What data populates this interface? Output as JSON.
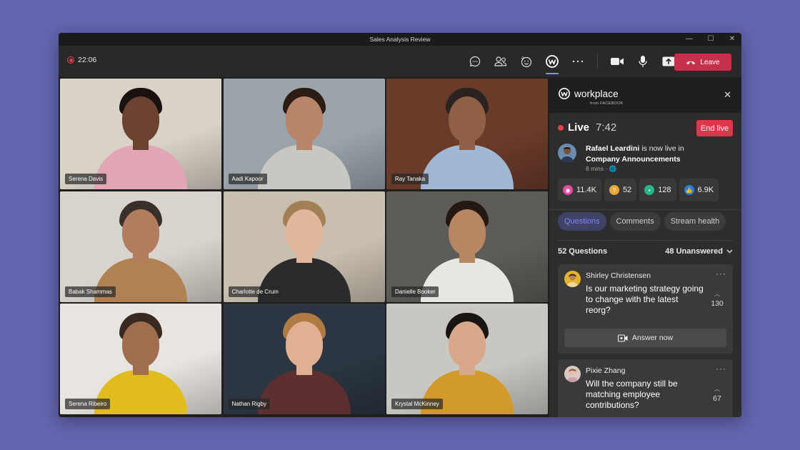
{
  "window": {
    "title": "Sales Analysis Review",
    "controls": [
      "—",
      "☐",
      "✕"
    ]
  },
  "toolbar": {
    "timer": "22:06",
    "icons": [
      "chat-icon",
      "participants-icon",
      "reactions-icon",
      "workplace-icon",
      "more-icon",
      "camera-icon",
      "mic-icon",
      "share-icon"
    ],
    "leave_label": "Leave",
    "leave_color": "#c4314b"
  },
  "participants": [
    {
      "name": "Serena Davis",
      "bg": "#d9d2c7",
      "skin": "#6b4330",
      "hair": "#1a1210",
      "shirt": "#e2a6b6"
    },
    {
      "name": "Aadi Kapoor",
      "bg": "#9ba3ab",
      "skin": "#b98568",
      "hair": "#2b1c14",
      "shirt": "#c8c7c2"
    },
    {
      "name": "Ray Tanaka",
      "bg": "#6b3b2a",
      "skin": "#8f6045",
      "hair": "#2a2320",
      "shirt": "#9fb7d3"
    },
    {
      "name": "Babak Shammas",
      "bg": "#d8d4cd",
      "skin": "#b27c5f",
      "hair": "#3a302a",
      "shirt": "#b08252"
    },
    {
      "name": "Charlotte de Crum",
      "bg": "#c9bfb0",
      "skin": "#e0b79a",
      "hair": "#a37f55",
      "shirt": "#2b2b2d"
    },
    {
      "name": "Danielle Booker",
      "bg": "#5e5c57",
      "skin": "#b88662",
      "hair": "#241812",
      "shirt": "#e8e6e2"
    },
    {
      "name": "Serena Ribeiro",
      "bg": "#e8e4df",
      "skin": "#a06d4f",
      "hair": "#3a2a22",
      "shirt": "#e0bc1f"
    },
    {
      "name": "Nathan Rigby",
      "bg": "#2b3642",
      "skin": "#e0b092",
      "hair": "#b07a45",
      "shirt": "#5c2f30"
    },
    {
      "name": "Krystal McKinney",
      "bg": "#c9c7c2",
      "skin": "#d7a98a",
      "hair": "#1a1412",
      "shirt": "#d29a2b"
    }
  ],
  "panel": {
    "brand": "workplace",
    "brand_sub": "from FACEBOOK",
    "live_label": "Live",
    "live_time": "7:42",
    "end_live_label": "End live",
    "announce": {
      "name": "Rafael Leardini",
      "text": " is now live in",
      "group": "Company Announcements",
      "meta": "8 mins · 🌐"
    },
    "stats": [
      {
        "icon": "views-icon",
        "glyph": "◉",
        "color": "#e04ca0",
        "value": "11.4K"
      },
      {
        "icon": "questions-icon",
        "glyph": "?",
        "color": "#e7a83a",
        "value": "52"
      },
      {
        "icon": "comments-icon",
        "glyph": "▪",
        "color": "#2bb58a",
        "value": "128"
      },
      {
        "icon": "likes-icon",
        "glyph": "👍",
        "color": "#2a7de0",
        "value": "6.9K"
      }
    ],
    "tabs": [
      "Questions",
      "Comments",
      "Stream health"
    ],
    "questions_count": "52 Questions",
    "unanswered": "48 Unanswered",
    "questions": [
      {
        "name": "Shirley Christensen",
        "text": "Is our marketing strategy going to change with the latest reorg?",
        "votes": "130",
        "answer_label": "Answer now"
      },
      {
        "name": "Pixie Zhang",
        "text": "Will the company still be matching employee contributions?",
        "votes": "67"
      }
    ]
  }
}
